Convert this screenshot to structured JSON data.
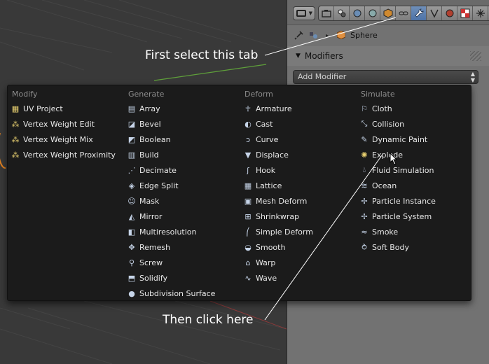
{
  "header_tabs": [
    {
      "icon": "camera-render-icon"
    },
    {
      "icon": "render-layers-icon"
    },
    {
      "icon": "scene-icon"
    },
    {
      "icon": "world-icon"
    },
    {
      "icon": "object-icon"
    },
    {
      "icon": "constraints-icon"
    },
    {
      "icon": "modifiers-wrench-icon",
      "active": true
    },
    {
      "icon": "data-vertex-icon"
    },
    {
      "icon": "material-icon"
    },
    {
      "icon": "texture-icon"
    },
    {
      "icon": "particles-icon"
    },
    {
      "icon": "physics-icon"
    }
  ],
  "context": {
    "object_name": "Sphere"
  },
  "panel": {
    "title": "Modifiers"
  },
  "add_modifier": {
    "label": "Add Modifier"
  },
  "menu": {
    "modify": {
      "title": "Modify",
      "items": [
        "UV Project",
        "Vertex Weight Edit",
        "Vertex Weight Mix",
        "Vertex Weight Proximity"
      ]
    },
    "generate": {
      "title": "Generate",
      "items": [
        "Array",
        "Bevel",
        "Boolean",
        "Build",
        "Decimate",
        "Edge Split",
        "Mask",
        "Mirror",
        "Multiresolution",
        "Remesh",
        "Screw",
        "Solidify",
        "Subdivision Surface"
      ]
    },
    "deform": {
      "title": "Deform",
      "items": [
        "Armature",
        "Cast",
        "Curve",
        "Displace",
        "Hook",
        "Lattice",
        "Mesh Deform",
        "Shrinkwrap",
        "Simple Deform",
        "Smooth",
        "Warp",
        "Wave"
      ]
    },
    "simulate": {
      "title": "Simulate",
      "items": [
        "Cloth",
        "Collision",
        "Dynamic Paint",
        "Explode",
        "Fluid Simulation",
        "Ocean",
        "Particle Instance",
        "Particle System",
        "Smoke",
        "Soft Body"
      ]
    }
  },
  "annotations": {
    "first": "First select this tab",
    "second": "Then click here"
  },
  "colors": {
    "viewport_bg": "#393939",
    "menu_bg": "#1b1b1b",
    "active_tab": "#5680c2",
    "annotation_text": "#ffffff"
  }
}
